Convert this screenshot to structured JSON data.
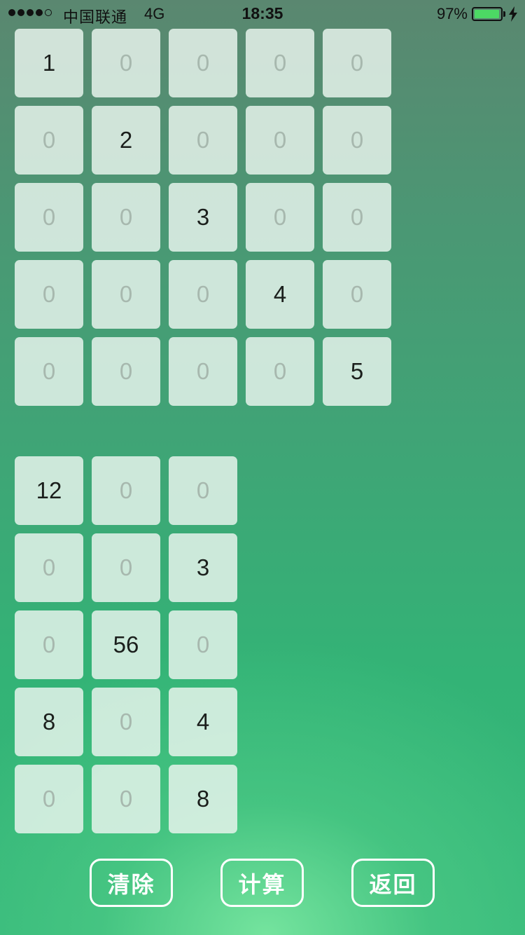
{
  "status_bar": {
    "carrier": "中国联通",
    "network": "4G",
    "time": "18:35",
    "battery_percent": "97%",
    "signal_bars_filled": 4,
    "signal_bars_total": 5,
    "battery_level": 0.97,
    "charging": true,
    "battery_color": "#4cd964"
  },
  "matrix_a": [
    [
      "1",
      "0",
      "0",
      "0",
      "0"
    ],
    [
      "0",
      "2",
      "0",
      "0",
      "0"
    ],
    [
      "0",
      "0",
      "3",
      "0",
      "0"
    ],
    [
      "0",
      "0",
      "0",
      "4",
      "0"
    ],
    [
      "0",
      "0",
      "0",
      "0",
      "5"
    ]
  ],
  "matrix_b": [
    [
      "12",
      "0",
      "0"
    ],
    [
      "0",
      "0",
      "3"
    ],
    [
      "0",
      "56",
      "0"
    ],
    [
      "8",
      "0",
      "4"
    ],
    [
      "0",
      "0",
      "8"
    ]
  ],
  "buttons": {
    "clear": "清除",
    "calculate": "计算",
    "back": "返回"
  },
  "colors": {
    "accent_top": "#5a8770",
    "accent_bottom": "#35b87a",
    "zero_text": "#a7b8ae",
    "value_text": "#1b1f1c"
  }
}
